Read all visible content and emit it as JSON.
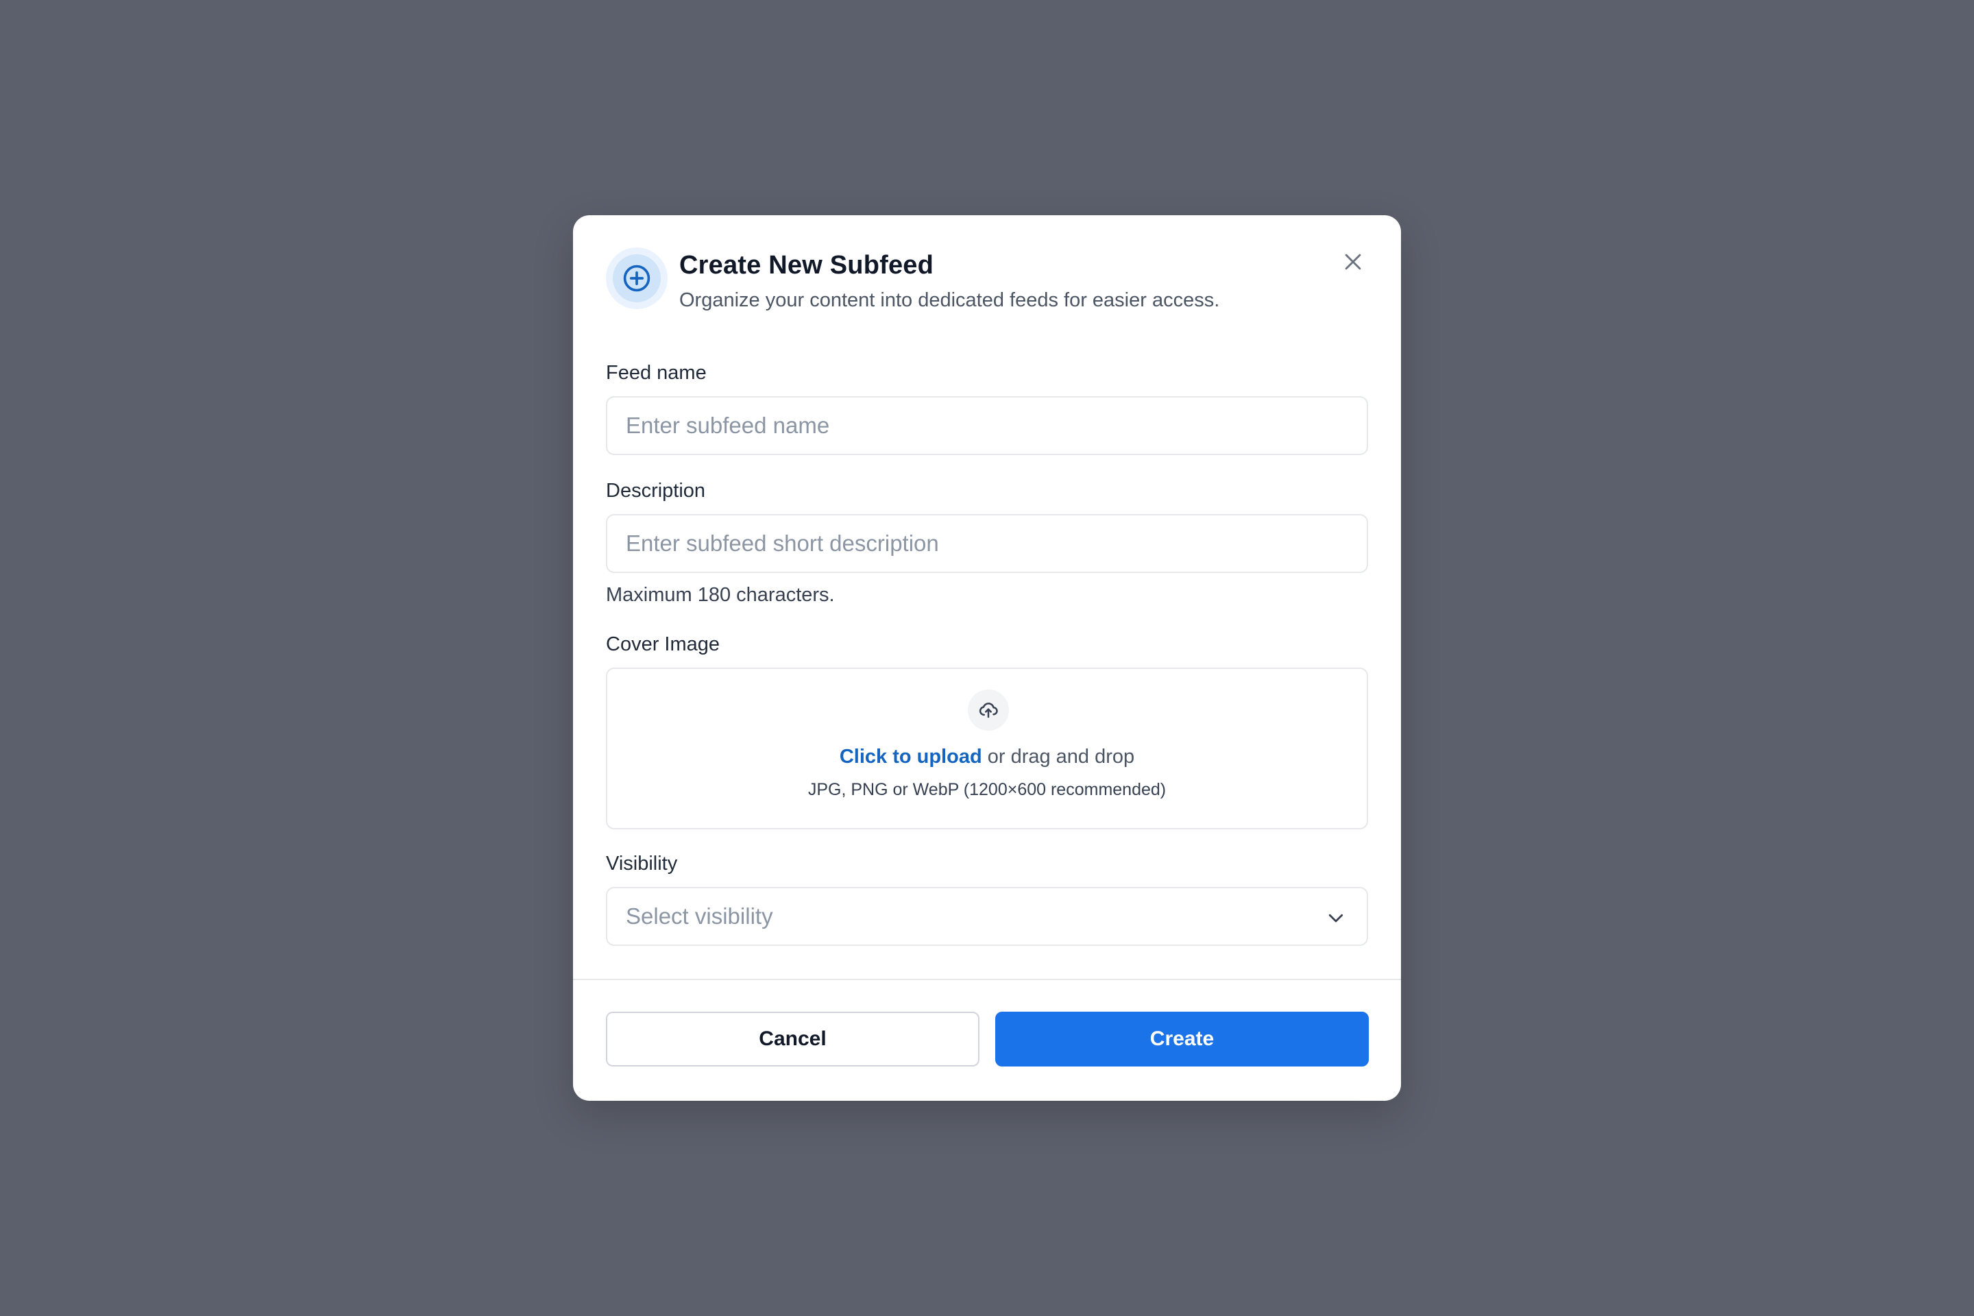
{
  "dialog": {
    "title": "Create New Subfeed",
    "subtitle": "Organize your content into dedicated feeds for easier access.",
    "header_icon": "plus-circle-icon",
    "close_icon": "close-icon"
  },
  "form": {
    "feed_name": {
      "label": "Feed name",
      "value": "",
      "placeholder": "Enter subfeed name"
    },
    "description": {
      "label": "Description",
      "value": "",
      "placeholder": "Enter subfeed short description",
      "helper": "Maximum 180 characters."
    },
    "cover_image": {
      "label": "Cover Image",
      "icon": "cloud-upload-icon",
      "link_text": "Click to upload",
      "rest_text": " or drag and drop",
      "hint": "JPG, PNG or WebP (1200×600 recommended)"
    },
    "visibility": {
      "label": "Visibility",
      "placeholder": "Select visibility",
      "icon": "chevron-down-icon"
    }
  },
  "footer": {
    "cancel_label": "Cancel",
    "create_label": "Create"
  },
  "colors": {
    "overlay": "#5c606c",
    "primary": "#1a73e8",
    "link": "#1565c0",
    "icon_bg": "#cfe3f9"
  }
}
